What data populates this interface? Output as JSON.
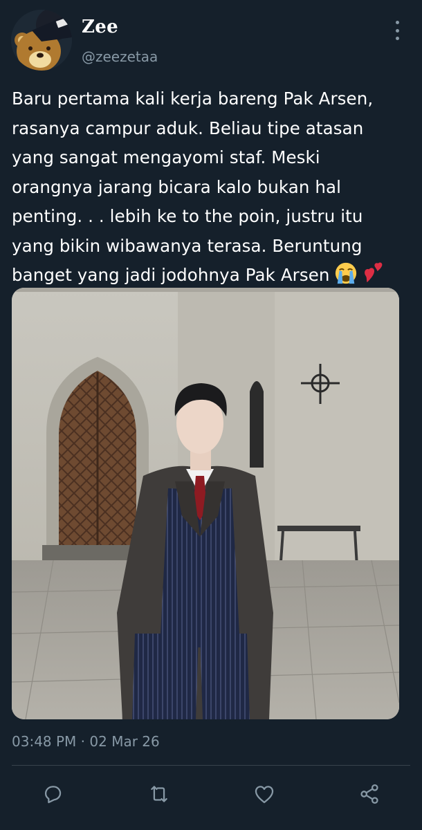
{
  "author": {
    "display_name": "Zee",
    "handle": "@zeezetaa",
    "avatar_icon": "bear-avatar-icon"
  },
  "tweet": {
    "text": "Baru pertama kali kerja bareng Pak Arsen,\nrasanya campur aduk.  Beliau tipe atasan\nyang sangat mengayomi staf.  Meski\norangnya jarang bicara kalo bukan hal\npenting. . .  lebih ke to the poin,  justru itu\nyang bikin wibawanya terasa.  Beruntung\nbanget yang jadi jodohnya Pak Arsen",
    "emojis": [
      "loudly-crying-face-icon",
      "two-hearts-icon"
    ],
    "timestamp": "03:48 PM · 02 Mar 26"
  },
  "actions": {
    "reply_icon": "reply-icon",
    "retweet_icon": "retweet-icon",
    "like_icon": "like-icon",
    "share_icon": "share-icon"
  },
  "colors": {
    "background": "#15202b",
    "text_primary": "#ffffff",
    "text_secondary": "#8899a6",
    "divider": "#38444d"
  }
}
